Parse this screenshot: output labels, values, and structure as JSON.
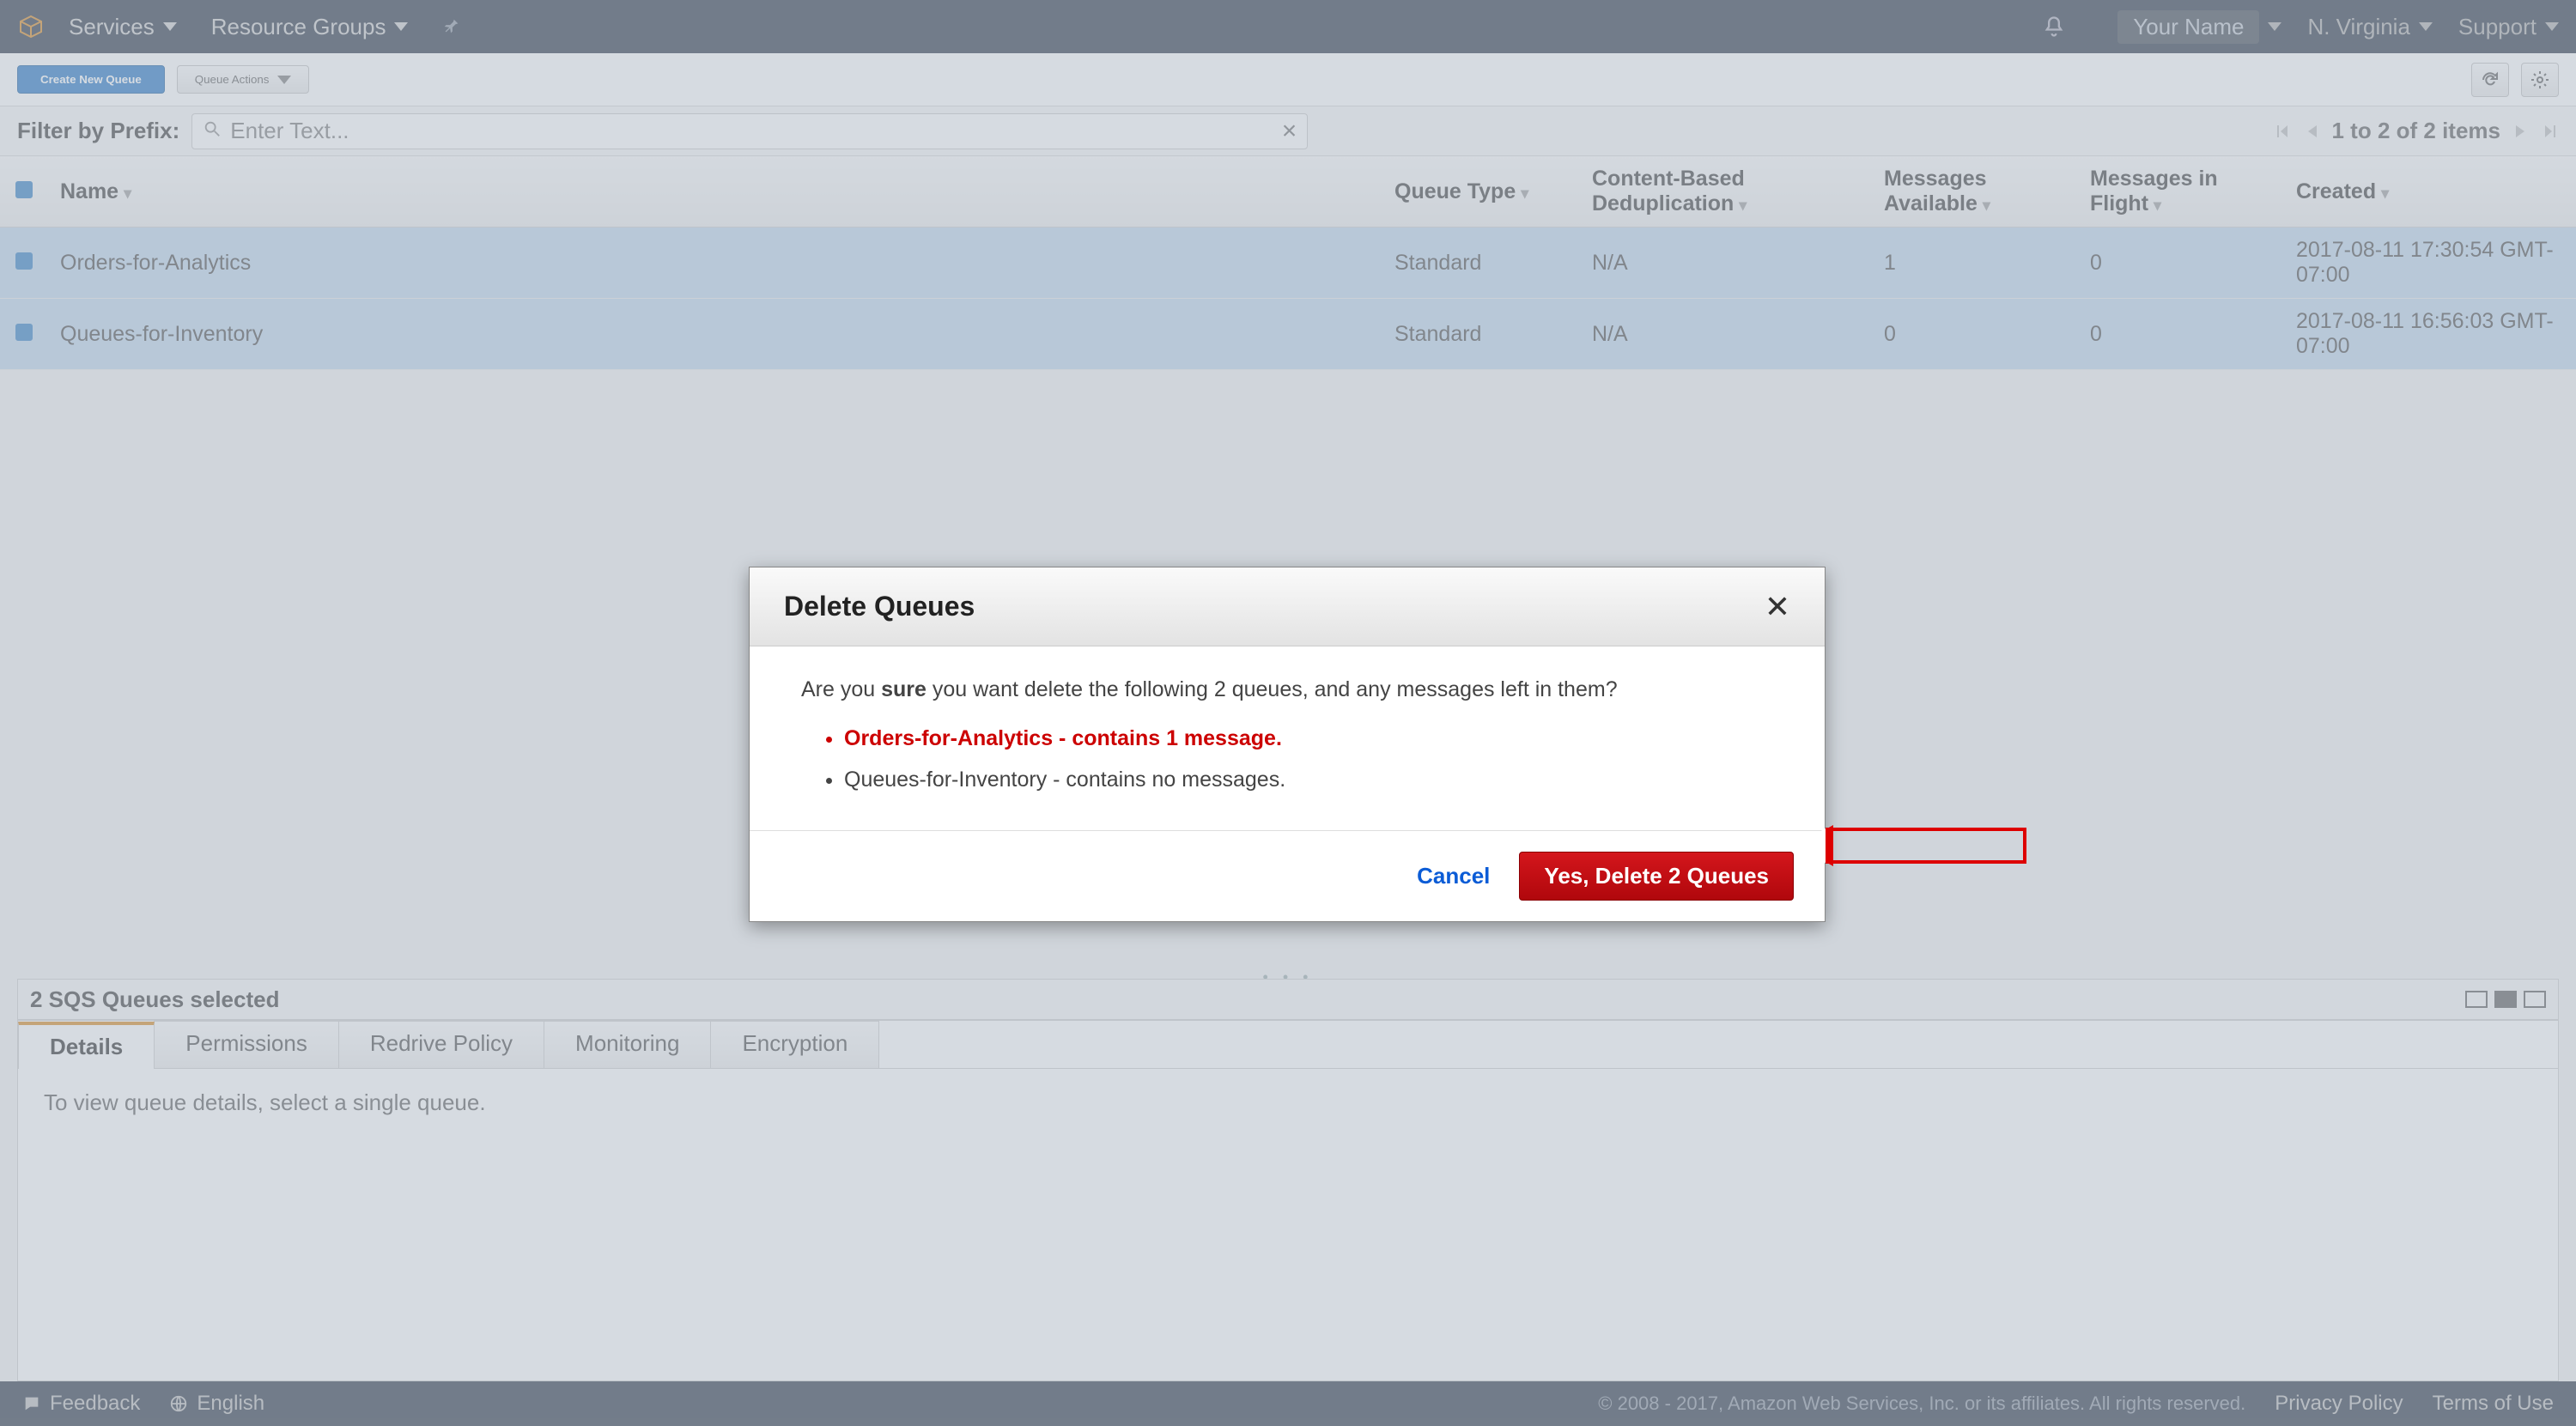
{
  "topnav": {
    "services": "Services",
    "resource_groups": "Resource Groups",
    "your_name": "Your Name",
    "region": "N. Virginia",
    "support": "Support"
  },
  "actionbar": {
    "create": "Create New Queue",
    "queue_actions": "Queue Actions"
  },
  "filter": {
    "label": "Filter by Prefix:",
    "placeholder": "Enter Text...",
    "pager_text": "1 to 2 of 2 items"
  },
  "columns": {
    "name": "Name",
    "queue_type": "Queue Type",
    "dedup": "Content-Based Deduplication",
    "msgs_avail": "Messages Available",
    "msgs_flight": "Messages in Flight",
    "created": "Created"
  },
  "rows": [
    {
      "name": "Orders-for-Analytics",
      "type": "Standard",
      "dedup": "N/A",
      "avail": "1",
      "flight": "0",
      "created": "2017-08-11 17:30:54 GMT-07:00"
    },
    {
      "name": "Queues-for-Inventory",
      "type": "Standard",
      "dedup": "N/A",
      "avail": "0",
      "flight": "0",
      "created": "2017-08-11 16:56:03 GMT-07:00"
    }
  ],
  "bottom": {
    "selected_text": "2 SQS Queues selected",
    "tabs": {
      "details": "Details",
      "permissions": "Permissions",
      "redrive": "Redrive Policy",
      "monitoring": "Monitoring",
      "encryption": "Encryption"
    },
    "body_text": "To view queue details, select a single queue."
  },
  "footer": {
    "feedback": "Feedback",
    "language": "English",
    "copyright": "© 2008 - 2017, Amazon Web Services, Inc. or its affiliates. All rights reserved.",
    "privacy": "Privacy Policy",
    "terms": "Terms of Use"
  },
  "modal": {
    "title": "Delete Queues",
    "intro_pre": "Are you ",
    "intro_strong": "sure",
    "intro_post": " you want delete the following 2 queues, and any messages left in them?",
    "item1": "Orders-for-Analytics - contains 1 message.",
    "item2": "Queues-for-Inventory - contains no messages.",
    "cancel": "Cancel",
    "confirm": "Yes, Delete 2 Queues"
  }
}
